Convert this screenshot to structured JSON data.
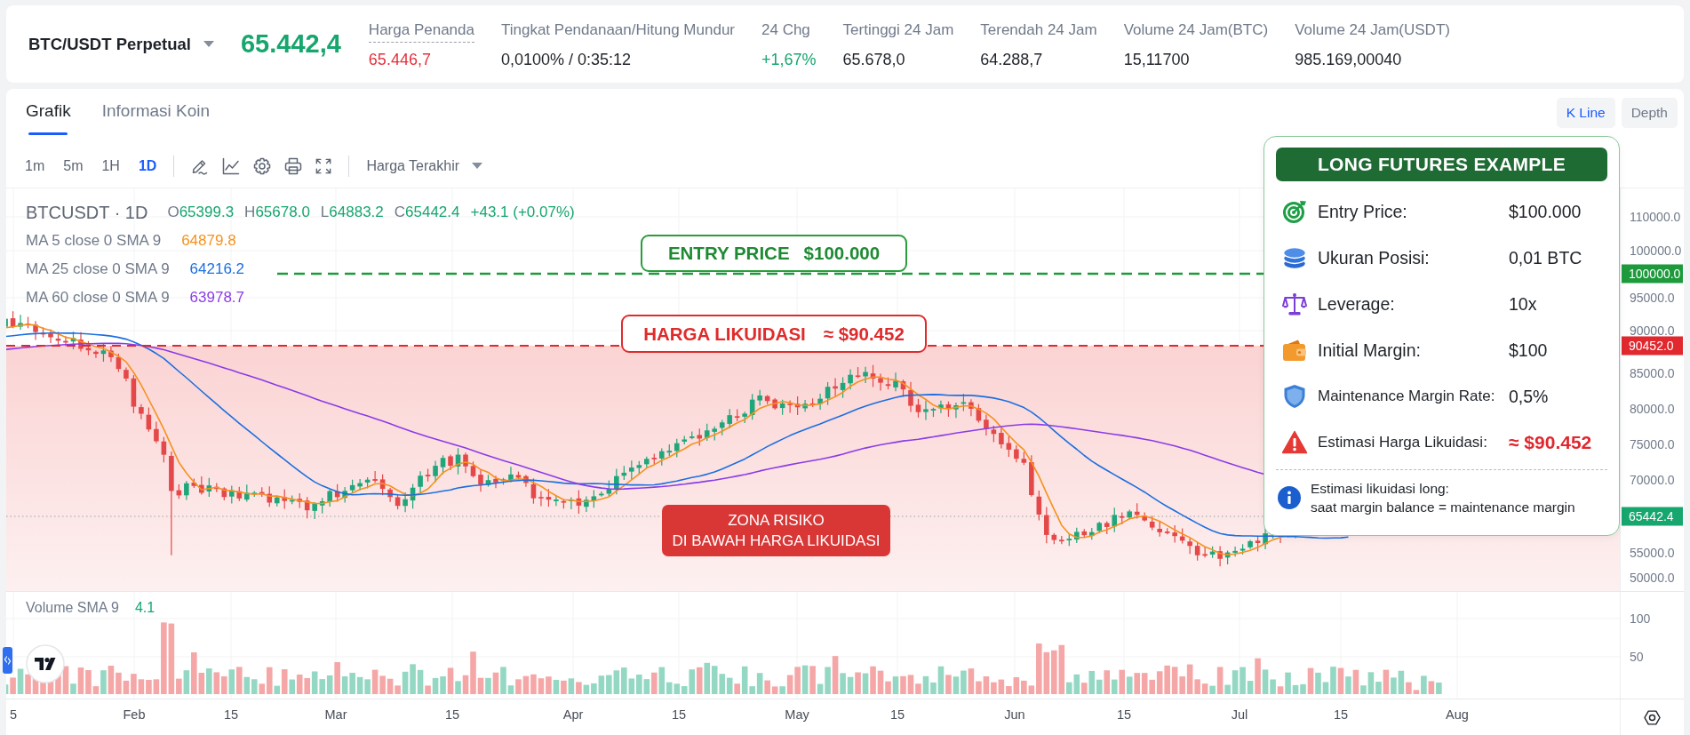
{
  "header": {
    "symbol": "BTC/USDT Perpetual",
    "last_price": {
      "value": "65.442,4",
      "positive": true
    },
    "stats": [
      {
        "label": "Harga Penanda",
        "value": "65.446,7",
        "color": "#e5303b",
        "hint": true
      },
      {
        "label": "Tingkat Pendanaan/Hitung Mundur",
        "value": "0,0100% / 0:35:12",
        "color": "#1e2329",
        "hint": false
      },
      {
        "label": "24 Chg",
        "value": "+1,67%",
        "color": "#16a66e",
        "hint": false
      },
      {
        "label": "Tertinggi 24 Jam",
        "value": "65.678,0",
        "color": "#1e2329",
        "hint": false
      },
      {
        "label": "Terendah 24 Jam",
        "value": "64.288,7",
        "color": "#1e2329",
        "hint": false
      },
      {
        "label": "Volume 24 Jam(BTC)",
        "value": "15,11700",
        "color": "#1e2329",
        "hint": false
      },
      {
        "label": "Volume 24 Jam(USDT)",
        "value": "985.169,00040",
        "color": "#1e2329",
        "hint": false
      }
    ]
  },
  "tabs": [
    {
      "label": "Grafik",
      "selected": true
    },
    {
      "label": "Informasi Koin",
      "selected": false
    }
  ],
  "view_toggle": [
    {
      "label": "K Line",
      "selected": true
    },
    {
      "label": "Depth",
      "selected": false
    }
  ],
  "toolbar": {
    "intervals": [
      {
        "label": "1m",
        "selected": false
      },
      {
        "label": "5m",
        "selected": false
      },
      {
        "label": "1H",
        "selected": false
      },
      {
        "label": "1D",
        "selected": true
      }
    ],
    "price_source": "Harga Terakhir"
  },
  "chart": {
    "legend": {
      "symbol": "BTCUSDT · 1D",
      "ohlc": [
        {
          "key": "O",
          "value": "65399.3"
        },
        {
          "key": "H",
          "value": "65678.0"
        },
        {
          "key": "L",
          "value": "64883.2"
        },
        {
          "key": "C",
          "value": "65442.4"
        }
      ],
      "change": "+43.1 (+0.07%)",
      "positive": true
    },
    "indicators": [
      {
        "label": "MA 5 close 0 SMA 9",
        "value": "64879.8",
        "color": "#f5921e"
      },
      {
        "label": "MA 25 close 0 SMA 9",
        "value": "64216.2",
        "color": "#1d6fe0"
      },
      {
        "label": "MA 60 close 0 SMA 9",
        "value": "63978.7",
        "color": "#8b3ce8"
      }
    ],
    "entry_callout": {
      "label": "ENTRY PRICE",
      "value": "$100.000"
    },
    "liquidation_callout": {
      "label": "HARGA LIKUIDASI",
      "value": "≈ $90.452"
    },
    "risk_zone": {
      "lines": [
        "ZONA RISIKO",
        "DI BAWAH HARGA LIKUIDASI"
      ]
    },
    "price_axis": {
      "ticks": [
        "110000.0",
        "100000.0",
        "95000.0",
        "90000.0",
        "85000.0",
        "80000.0",
        "75000.0",
        "70000.0",
        "55000.0",
        "50000.0"
      ],
      "tags": [
        {
          "label": "100000.0",
          "color": "#1e9a3c"
        },
        {
          "label": "90452.0",
          "color": "#e0282e"
        },
        {
          "label": "65442.4",
          "color": "#16a66e"
        }
      ]
    },
    "volume": {
      "label": "Volume SMA 9",
      "value": "4.1",
      "positive": true,
      "ticks": [
        "100",
        "50"
      ]
    },
    "time_axis": [
      "5",
      "Feb",
      "15",
      "Mar",
      "15",
      "Apr",
      "15",
      "May",
      "15",
      "Jun",
      "15",
      "Jul",
      "15",
      "Aug"
    ]
  },
  "example_panel": {
    "title": "LONG FUTURES EXAMPLE",
    "rows": [
      {
        "label": "Entry Price:",
        "value": "$100.000",
        "alert": false
      },
      {
        "label": "Ukuran Posisi:",
        "value": "0,01 BTC",
        "alert": false
      },
      {
        "label": "Leverage:",
        "value": "10x",
        "alert": false
      },
      {
        "label": "Initial Margin:",
        "value": "$100",
        "alert": false
      },
      {
        "label": "Maintenance Margin Rate:",
        "value": "0,5%",
        "alert": false
      },
      {
        "label": "Estimasi Harga Likuidasi:",
        "value": "≈ $90.452",
        "alert": true
      }
    ],
    "note": {
      "lines": [
        "Estimasi likuidasi long:",
        "saat margin balance = maintenance margin"
      ]
    }
  }
}
